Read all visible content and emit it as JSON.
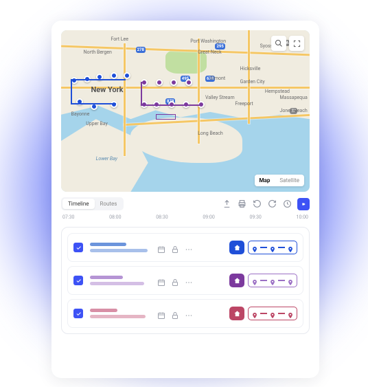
{
  "map": {
    "type_map": "Map",
    "type_satellite": "Satellite",
    "labels": [
      "New York",
      "Fort Lee",
      "North Bergen",
      "Port Washington",
      "Great Neck",
      "Hicksville",
      "Syosset",
      "Garden City",
      "Hempstead",
      "Elmont",
      "Valley Stream",
      "Freeport",
      "Massapequa",
      "Jones Beach",
      "Long Beach",
      "Bayonne",
      "Upper Bay",
      "Lower Bay"
    ],
    "highways": [
      "278",
      "495",
      "678",
      "295",
      "878",
      "25A",
      "27"
    ]
  },
  "toolbar": {
    "tabs": [
      "Timeline",
      "Routes"
    ]
  },
  "timeline": [
    "07:30",
    "08:00",
    "08:30",
    "09:00",
    "09:30",
    "10:00"
  ],
  "routes": [
    {
      "checked": true,
      "color": "#1f4fd8",
      "stops": 3
    },
    {
      "checked": true,
      "color": "#7c3a9e",
      "stops": 3
    },
    {
      "checked": true,
      "color": "#bc4665",
      "stops": 3
    }
  ],
  "colors": {
    "accent": "#3d52f5",
    "blue": "#1f4fd8",
    "purple": "#7c3a9e",
    "red": "#bc4665"
  }
}
